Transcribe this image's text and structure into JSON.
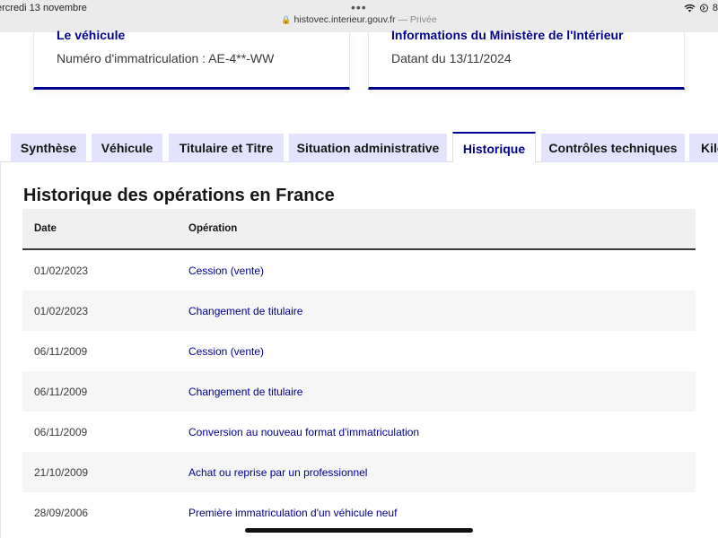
{
  "statusbar": {
    "date": "ercredi 13 novembre",
    "url": "histovec.interieur.gouv.fr",
    "private_label": "— Privée",
    "battery": "8"
  },
  "cards": [
    {
      "title": "Le véhicule",
      "text": "Numéro d'immatriculation : AE-4**-WW"
    },
    {
      "title": "Informations du Ministère de l'Intérieur",
      "text": "Datant du 13/11/2024"
    }
  ],
  "tabs": [
    {
      "label": "Synthèse"
    },
    {
      "label": "Véhicule"
    },
    {
      "label": "Titulaire et Titre"
    },
    {
      "label": "Situation administrative"
    },
    {
      "label": "Historique"
    },
    {
      "label": "Contrôles techniques"
    },
    {
      "label": "Kilo"
    }
  ],
  "history": {
    "title": "Historique des opérations en France",
    "columns": {
      "date": "Date",
      "operation": "Opération"
    },
    "rows": [
      {
        "date": "01/02/2023",
        "operation": "Cession (vente)"
      },
      {
        "date": "01/02/2023",
        "operation": "Changement de titulaire"
      },
      {
        "date": "06/11/2009",
        "operation": "Cession (vente)"
      },
      {
        "date": "06/11/2009",
        "operation": "Changement de titulaire"
      },
      {
        "date": "06/11/2009",
        "operation": "Conversion au nouveau format d'immatriculation"
      },
      {
        "date": "21/10/2009",
        "operation": "Achat ou reprise par un professionnel"
      },
      {
        "date": "28/09/2006",
        "operation": "Première immatriculation d'un véhicule neuf"
      }
    ]
  },
  "colors": {
    "accent": "#000091",
    "tab_background": "#e3e3fd"
  }
}
